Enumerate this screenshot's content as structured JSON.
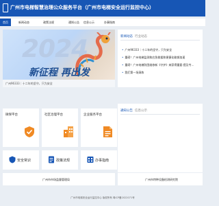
{
  "header": {
    "title": "广州市电梯智慧治理公众服务平台（广州市电梯安全运行监控中心）"
  },
  "nav": {
    "items": [
      "首页",
      "新闻动态",
      "政策法规",
      "通知公告",
      "信息公示",
      "办事指南"
    ],
    "active_index": 0
  },
  "banner": {
    "year": "2024",
    "slogan": "新征程 再出发",
    "caption": "广州96333｜十二年的坚守，只为安全",
    "slide_count": 3,
    "active_slide": 0
  },
  "news": {
    "tab_active": "新闻动态",
    "tab_other": "行业动态",
    "items": [
      "广州96333｜十二年的坚守，只为安全",
      "重磅！广州电梯监测和应急救援和便捷化能够加速",
      "重磅！广州电梯防困维修新《守护》来获得重要·提及专...",
      "我们第一场演练"
    ]
  },
  "notice": {
    "tab_active": "通知公告",
    "tab_other": "信息公示"
  },
  "tiles": [
    {
      "title": "微保平台",
      "icon": "shield-check-icon"
    },
    {
      "title": "社区治理平台",
      "icon": "building-icon"
    },
    {
      "title": "企业服务平台",
      "icon": "document-icon"
    }
  ],
  "services": [
    {
      "label": "安全常识",
      "icon": "shield-icon"
    },
    {
      "label": "政策法规",
      "icon": "rules-icon"
    },
    {
      "label": "办事指南",
      "icon": "guide-icon"
    }
  ],
  "footer_links": {
    "left": "广州市市场监督管理局",
    "right": "广州市特种设备检测研究院"
  },
  "footer": {
    "copyright": "广州市电梯安全运行监控中心 版权所有 粤ICP备2022071号"
  },
  "colors": {
    "brand": "#1756b5",
    "accent_orange": "#f08a24"
  }
}
